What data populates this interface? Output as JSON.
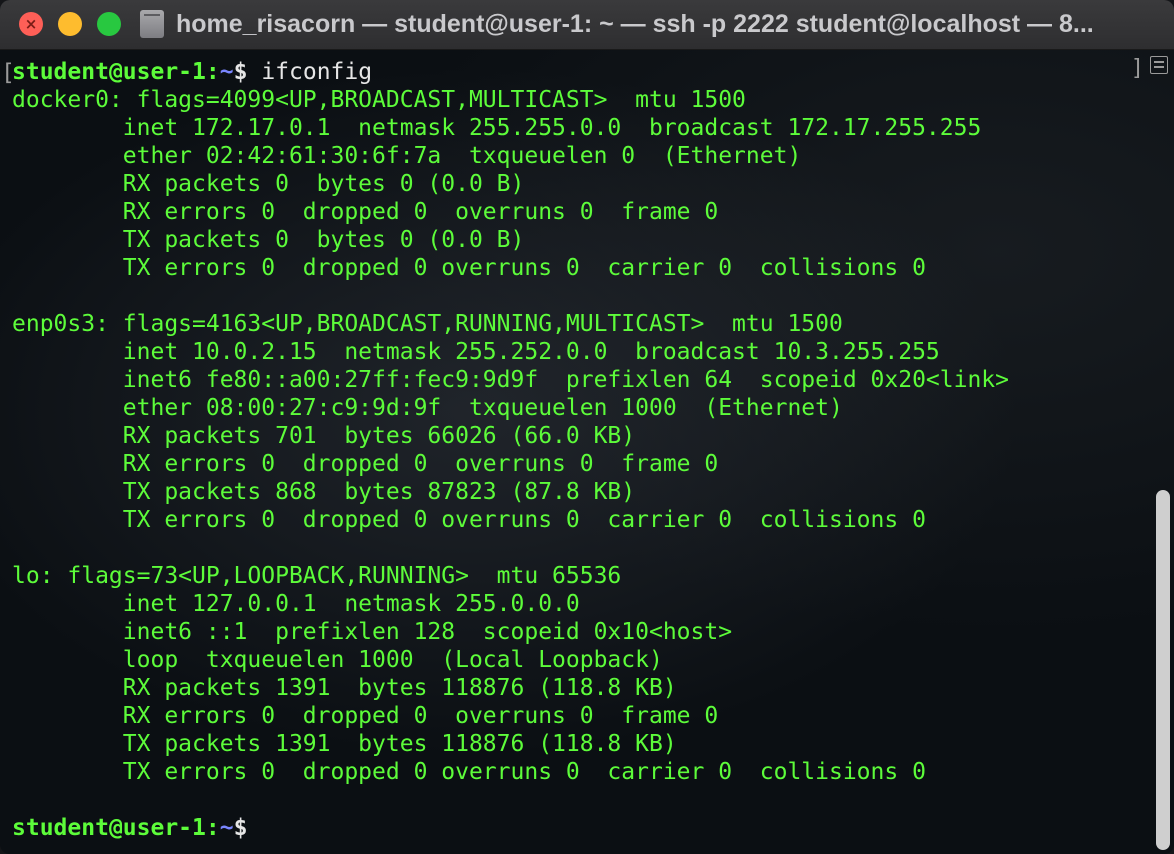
{
  "window": {
    "title": "home_risacorn — student@user-1: ~ — ssh -p 2222 student@localhost — 8...",
    "colors": {
      "close": "#fe5f57",
      "minimize": "#febc2e",
      "zoom": "#28c840",
      "terminal_text": "#5dfc3a",
      "path": "#7a86ff"
    }
  },
  "prompt": {
    "user": "student",
    "at": "@",
    "host": "user-1",
    "colon": ":",
    "path": "~",
    "symbol": "$",
    "command": " ifconfig"
  },
  "interfaces": [
    {
      "header": "docker0: flags=4099<UP,BROADCAST,MULTICAST>  mtu 1500",
      "lines": [
        "        inet 172.17.0.1  netmask 255.255.0.0  broadcast 172.17.255.255",
        "        ether 02:42:61:30:6f:7a  txqueuelen 0  (Ethernet)",
        "        RX packets 0  bytes 0 (0.0 B)",
        "        RX errors 0  dropped 0  overruns 0  frame 0",
        "        TX packets 0  bytes 0 (0.0 B)",
        "        TX errors 0  dropped 0 overruns 0  carrier 0  collisions 0"
      ]
    },
    {
      "header": "enp0s3: flags=4163<UP,BROADCAST,RUNNING,MULTICAST>  mtu 1500",
      "lines": [
        "        inet 10.0.2.15  netmask 255.252.0.0  broadcast 10.3.255.255",
        "        inet6 fe80::a00:27ff:fec9:9d9f  prefixlen 64  scopeid 0x20<link>",
        "        ether 08:00:27:c9:9d:9f  txqueuelen 1000  (Ethernet)",
        "        RX packets 701  bytes 66026 (66.0 KB)",
        "        RX errors 0  dropped 0  overruns 0  frame 0",
        "        TX packets 868  bytes 87823 (87.8 KB)",
        "        TX errors 0  dropped 0 overruns 0  carrier 0  collisions 0"
      ]
    },
    {
      "header": "lo: flags=73<UP,LOOPBACK,RUNNING>  mtu 65536",
      "lines": [
        "        inet 127.0.0.1  netmask 255.0.0.0",
        "        inet6 ::1  prefixlen 128  scopeid 0x10<host>",
        "        loop  txqueuelen 1000  (Local Loopback)",
        "        RX packets 1391  bytes 118876 (118.8 KB)",
        "        RX errors 0  dropped 0  overruns 0  frame 0",
        "        TX packets 1391  bytes 118876 (118.8 KB)",
        "        TX errors 0  dropped 0 overruns 0  carrier 0  collisions 0"
      ]
    }
  ]
}
